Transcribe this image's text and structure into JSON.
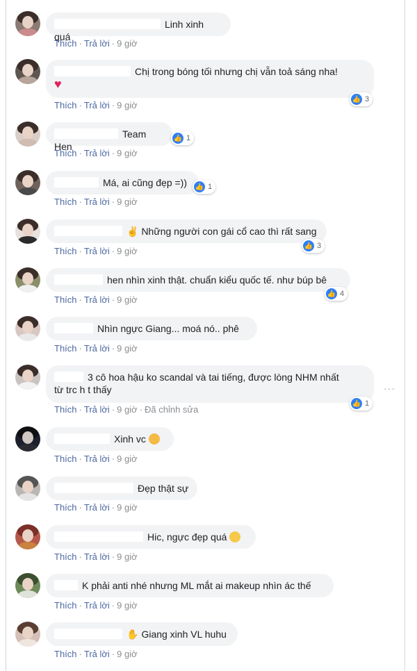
{
  "actions": {
    "like": "Thích",
    "reply": "Trả lời",
    "sep": "·",
    "edited": "Đã chỉnh sửa"
  },
  "comments": [
    {
      "text": "Linh xinh quá",
      "time": "9 giờ",
      "likes": ""
    },
    {
      "text": "Chị trong bóng tối nhưng chị vẫn toả sáng nha!",
      "time": "9 giờ",
      "likes": "3"
    },
    {
      "text": "Team Hen",
      "time": "9 giờ",
      "likes": "1"
    },
    {
      "text": "Má, ai cũng đẹp =))",
      "time": "9 giờ",
      "likes": "1"
    },
    {
      "text": "Những người con gái cổ cao thì rất sang",
      "time": "9 giờ",
      "likes": "3"
    },
    {
      "text": "hen nhìn xinh thật. chuẩn kiểu quốc tế. như búp bê",
      "time": "9 giờ",
      "likes": "4"
    },
    {
      "text": "Nhìn ngực Giang... moá nó.. phê",
      "time": "9 giờ",
      "likes": ""
    },
    {
      "text_line1": "3 cô hoa hậu ko scandal và tai tiếng, được lòng NHM nhất",
      "text_line2": "từ trc h t thấy",
      "time": "9 giờ",
      "likes": "1"
    },
    {
      "text": "Xinh vc",
      "time": "9 giờ",
      "likes": ""
    },
    {
      "text": "Đẹp thật sự",
      "time": "9 giờ",
      "likes": ""
    },
    {
      "text": "Hic, ngực đẹp quá",
      "time": "9 giờ",
      "likes": ""
    },
    {
      "text": "K phải anti nhé nhưng ML mắt ai makeup nhìn ác thế",
      "time": "9 giờ",
      "likes": ""
    },
    {
      "text": "Giang xinh VL huhu",
      "time": "9 giờ",
      "likes": ""
    }
  ]
}
